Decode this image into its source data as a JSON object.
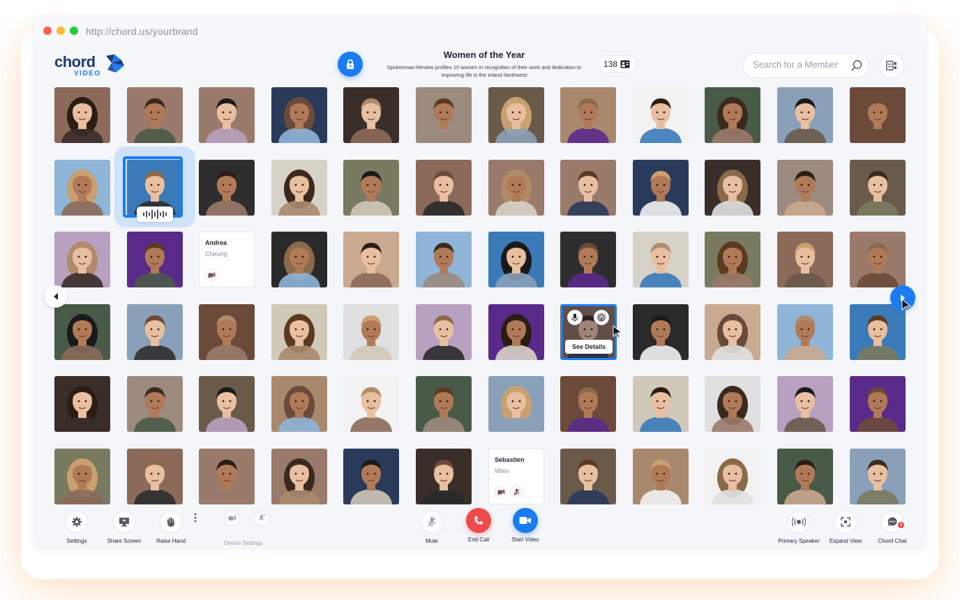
{
  "browser": {
    "url": "http://chord.us/yourbrand"
  },
  "brand": {
    "word": "chord",
    "sub": "VIDEO",
    "primary": "#1b7cf2",
    "dark": "#1d3b6e"
  },
  "event": {
    "title": "Women of the Year",
    "description": "Spokesman-Review profiles 10 women in recognition of their work and dedication to improving life in the Inland Northwest",
    "attendee_count": "138"
  },
  "search": {
    "placeholder": "Search for a Member",
    "value": ""
  },
  "grid": {
    "columns": 12,
    "rows": 6,
    "speaking_participant_index": 13,
    "hovered_participant_index": 43,
    "cards": [
      {
        "index": 26,
        "first_name": "Andrea",
        "last_name": "Cheung",
        "icons": [
          "video-off-icon"
        ]
      },
      {
        "index": 66,
        "first_name": "Sebastien",
        "last_name": "Miles",
        "icons": [
          "video-off-icon",
          "mic-off-icon"
        ]
      }
    ],
    "hover": {
      "details_label": "See Details"
    }
  },
  "toolbar": {
    "settings": "Settings",
    "share_screen": "Share Screen",
    "raise_hand": "Raise Hand",
    "device_settings": "Device Settings",
    "mute": "Mute",
    "end_call": "End Call",
    "start_video": "Start Video",
    "primary_speaker": "Primary Speaker",
    "expand_view": "Expand View",
    "chord_chat": "Chord Chat",
    "chat_unread": "4"
  },
  "colors": {
    "end_call": "#f04a4a",
    "accent": "#1b7cf2",
    "speaking_halo": "#cfe3fb"
  }
}
